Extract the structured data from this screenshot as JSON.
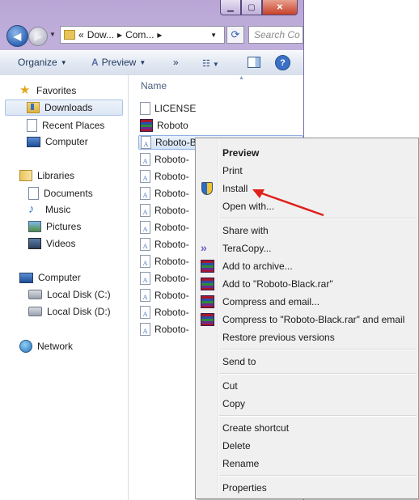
{
  "window": {
    "address": {
      "crumbs": [
        "«",
        "Dow...",
        "▸",
        "Com...",
        "▸"
      ]
    },
    "search_placeholder": "Search Co",
    "toolbar": {
      "organize": "Organize",
      "preview": "Preview",
      "more": "»"
    }
  },
  "nav": {
    "favorites": {
      "header": "Favorites",
      "items": [
        "Downloads",
        "Recent Places",
        "Computer"
      ]
    },
    "libraries": {
      "header": "Libraries",
      "items": [
        "Documents",
        "Music",
        "Pictures",
        "Videos"
      ]
    },
    "computer": {
      "header": "Computer",
      "items": [
        "Local Disk (C:)",
        "Local Disk (D:)"
      ]
    },
    "network": {
      "header": "Network"
    }
  },
  "files": {
    "column_name": "Name",
    "rows": [
      "LICENSE",
      "Roboto",
      "Roboto-Bl",
      "Roboto-",
      "Roboto-",
      "Roboto-",
      "Roboto-",
      "Roboto-",
      "Roboto-",
      "Roboto-",
      "Roboto-",
      "Roboto-",
      "Roboto-",
      "Roboto-"
    ]
  },
  "context_menu": {
    "items": {
      "preview": "Preview",
      "print": "Print",
      "install": "Install",
      "open_with": "Open with...",
      "share_with": "Share with",
      "teracopy": "TeraCopy...",
      "add_archive": "Add to archive...",
      "add_rar": "Add to \"Roboto-Black.rar\"",
      "compress_email": "Compress and email...",
      "compress_rar_email": "Compress to \"Roboto-Black.rar\" and email",
      "restore": "Restore previous versions",
      "send_to": "Send to",
      "cut": "Cut",
      "copy": "Copy",
      "create_shortcut": "Create shortcut",
      "delete": "Delete",
      "rename": "Rename",
      "properties": "Properties"
    }
  },
  "colors": {
    "annotation_arrow": "#e0201b",
    "selection": "#d3e3f7"
  }
}
